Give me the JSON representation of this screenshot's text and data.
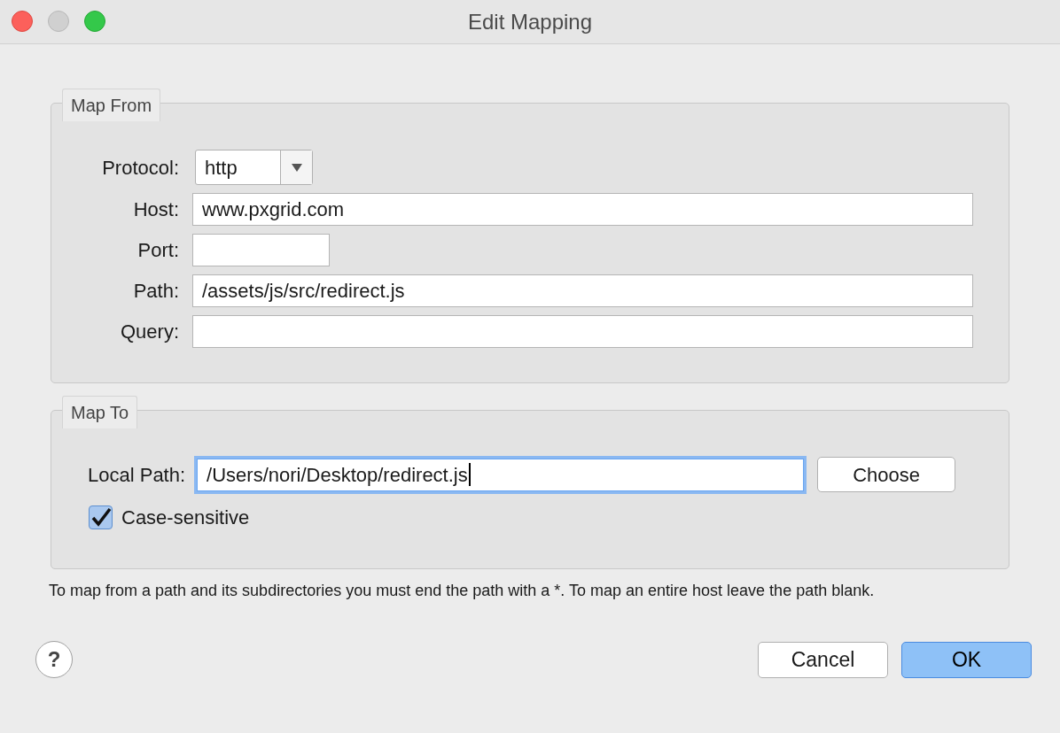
{
  "window": {
    "title": "Edit Mapping"
  },
  "map_from": {
    "legend": "Map From",
    "fields": [
      {
        "kind": "dropdown",
        "label": "Protocol:",
        "value": "http"
      },
      {
        "kind": "text",
        "label": "Host:",
        "value": "www.pxgrid.com"
      },
      {
        "kind": "short",
        "label": "Port:"
      },
      {
        "kind": "text",
        "label": "Path:",
        "value": "/assets/js/src/redirect.js"
      },
      {
        "kind": "text",
        "label": "Query:"
      }
    ]
  },
  "map_to": {
    "legend": "Map To",
    "local_path": {
      "label": "Local Path:",
      "value": "/Users/nori/Desktop/redirect.js",
      "focused": true
    },
    "choose_button": "Choose",
    "case_sensitive": {
      "label": "Case-sensitive",
      "checked": true
    }
  },
  "hint": "To map from a path and its subdirectories you must end the path with a *. To map an entire host leave the path blank.",
  "help_button": "?",
  "buttons": [
    {
      "label": "Cancel",
      "default": false
    },
    {
      "label": "OK",
      "default": true
    }
  ]
}
